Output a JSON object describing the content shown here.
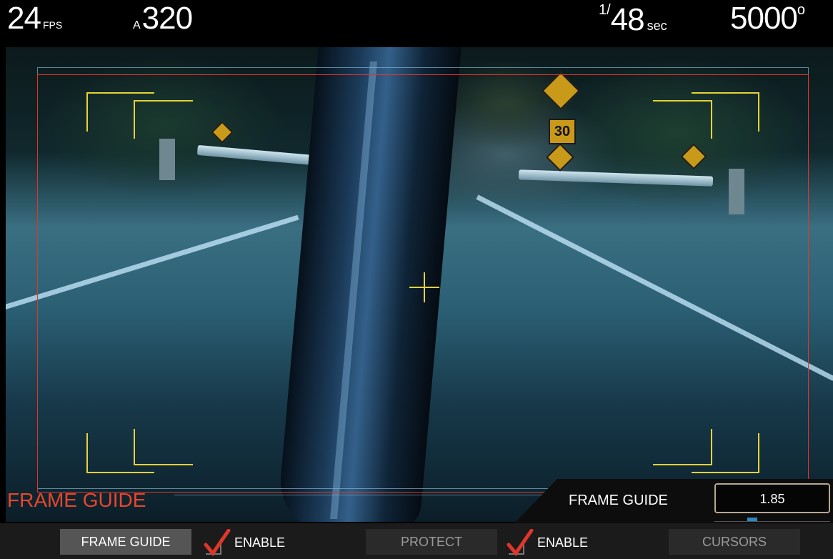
{
  "status": {
    "fps_value": "24",
    "fps_unit": "FPS",
    "iso_prefix": "A",
    "iso_value": "320",
    "shutter_numerator": "1/",
    "shutter_value": "48",
    "shutter_unit": "sec",
    "white_balance_value": "5000",
    "white_balance_unit": "o"
  },
  "scene": {
    "speed_sign_text": "30"
  },
  "menu": {
    "title": "FRAME GUIDE",
    "setting_label": "FRAME GUIDE",
    "setting_value": "1.85"
  },
  "toolbar": {
    "frame_guide_label": "FRAME GUIDE",
    "frame_guide_enable_label": "ENABLE",
    "frame_guide_enabled": true,
    "protect_label": "PROTECT",
    "protect_enable_label": "ENABLE",
    "protect_enabled": true,
    "cursors_label": "CURSORS"
  },
  "colors": {
    "accent_red": "#e8462c",
    "guide_yellow": "#e6d13a",
    "frame_red": "#e0362a",
    "slider_blue": "#2f88c4"
  }
}
